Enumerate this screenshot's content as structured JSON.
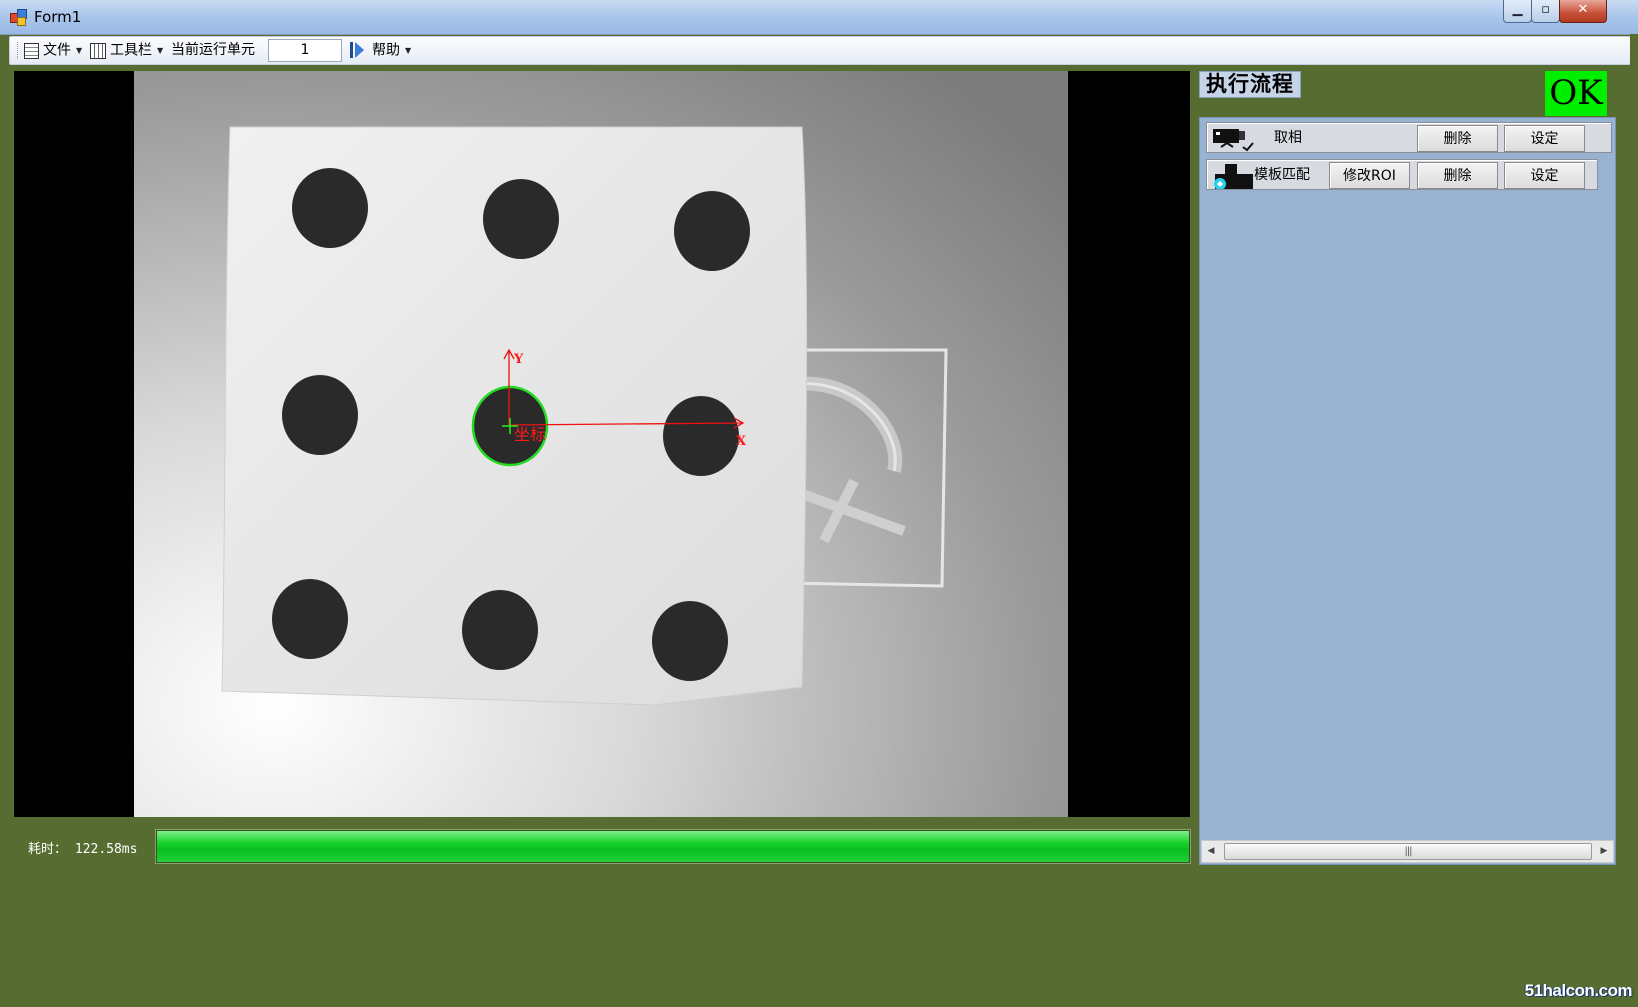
{
  "window": {
    "title": "Form1",
    "min_glyph": "▁",
    "max_glyph": "▫",
    "close_glyph": "✕"
  },
  "toolbar": {
    "file_label": "文件",
    "tools_label": "工具栏",
    "current_unit_label": "当前运行单元",
    "current_unit_value": "1",
    "help_label": "帮助"
  },
  "image": {
    "coord_label": "坐标",
    "y_axis_label": "Y",
    "x_axis_label": "X"
  },
  "status": {
    "elapsed_label": "耗时：",
    "elapsed_value": "122.58ms",
    "progress": 1.0,
    "progress_color": "#07c01f"
  },
  "flow": {
    "title": "执行流程",
    "result": "OK",
    "result_color": "#00ee00",
    "steps": [
      {
        "icon": "camera-icon",
        "label": "取相",
        "buttons": [
          "删除",
          "设定"
        ]
      },
      {
        "icon": "template-match-icon",
        "label": "模板匹配",
        "buttons": [
          "修改ROI",
          "删除",
          "设定"
        ]
      }
    ]
  },
  "scrollbar": {
    "thumb_glyph": "|||"
  },
  "watermark": "51halcon.com"
}
